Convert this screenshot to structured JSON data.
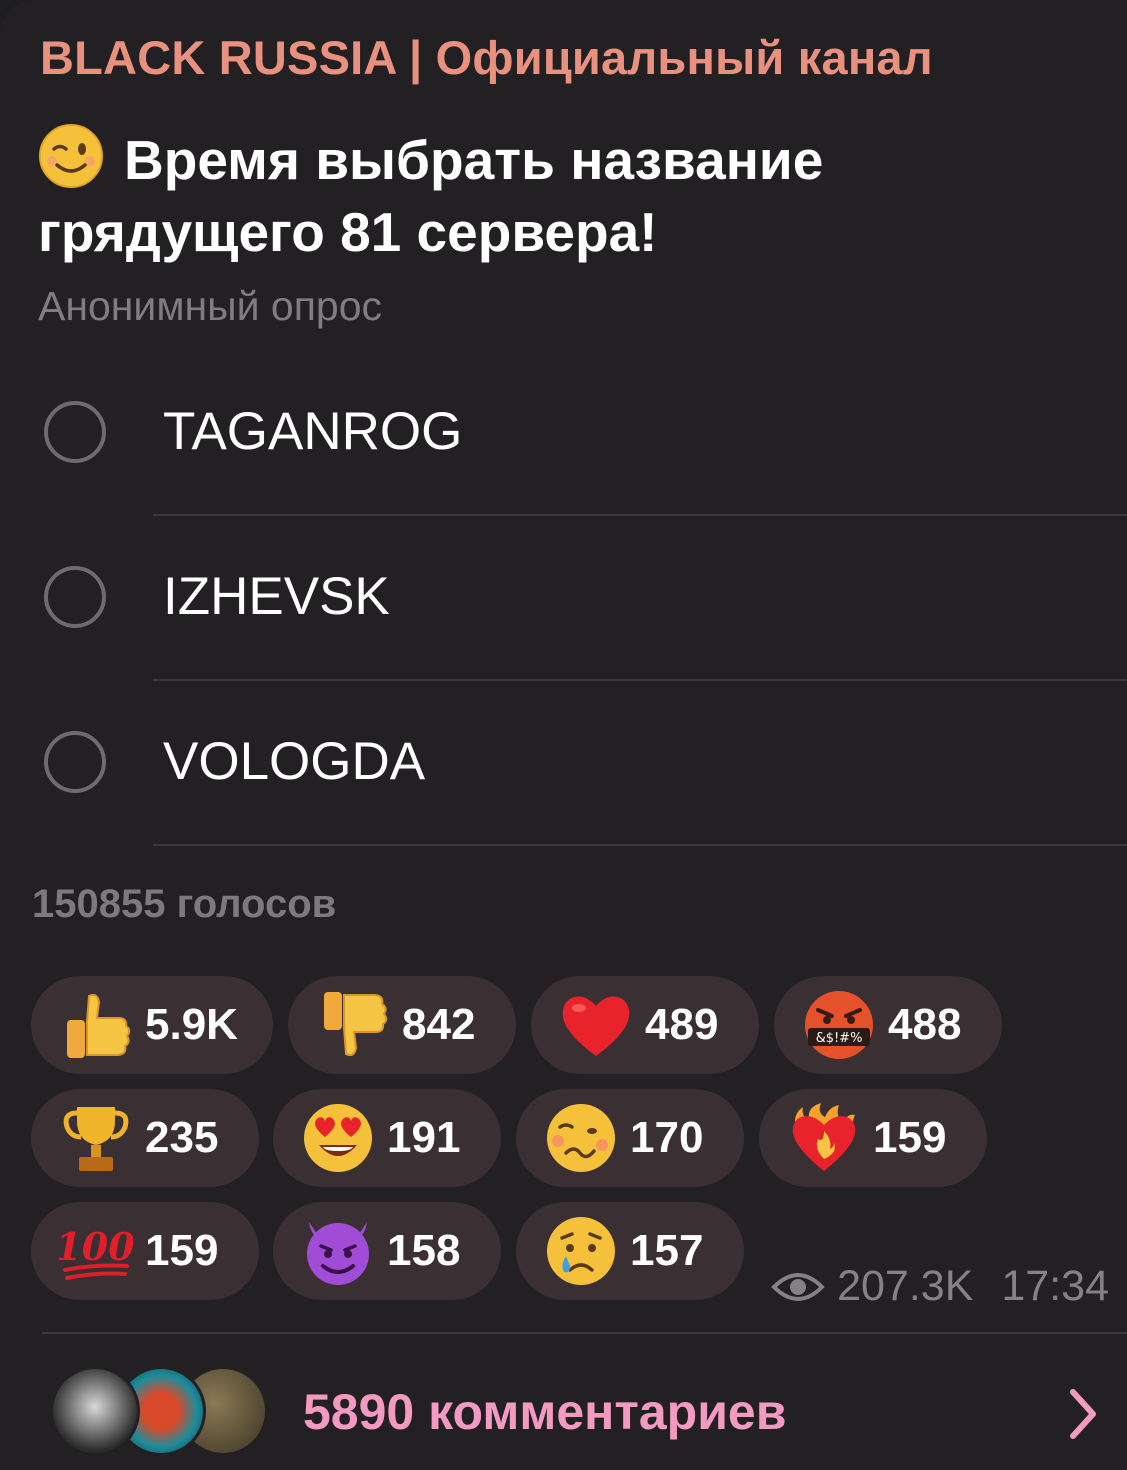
{
  "channel": {
    "name": "BLACK RUSSIA | Официальный канал"
  },
  "poll": {
    "question_emoji": "winking-face-icon",
    "question": "Время выбрать название грядущего 81 сервера!",
    "type": "Анонимный опрос",
    "options": [
      {
        "label": "TAGANROG"
      },
      {
        "label": "IZHEVSK"
      },
      {
        "label": "VOLOGDA"
      }
    ],
    "votes_text": "150855 голосов"
  },
  "reactions": [
    {
      "icon": "thumbs-up-icon",
      "count": "5.9K"
    },
    {
      "icon": "thumbs-down-icon",
      "count": "842"
    },
    {
      "icon": "red-heart-icon",
      "count": "489"
    },
    {
      "icon": "angry-face-with-symbols-icon",
      "count": "488"
    },
    {
      "icon": "trophy-icon",
      "count": "235"
    },
    {
      "icon": "heart-eyes-face-icon",
      "count": "191"
    },
    {
      "icon": "woozy-face-icon",
      "count": "170"
    },
    {
      "icon": "heart-on-fire-icon",
      "count": "159"
    },
    {
      "icon": "hundred-points-icon",
      "count": "159"
    },
    {
      "icon": "smiling-devil-icon",
      "count": "158"
    },
    {
      "icon": "crying-face-icon",
      "count": "157"
    }
  ],
  "meta": {
    "views": "207.3K",
    "time": "17:34"
  },
  "comments": {
    "text": "5890 комментариев"
  },
  "colors": {
    "accent_channel": "#e9917f",
    "comments_link": "#f29ac0",
    "reaction_bg": "#3a2f32",
    "background": "#222023"
  }
}
